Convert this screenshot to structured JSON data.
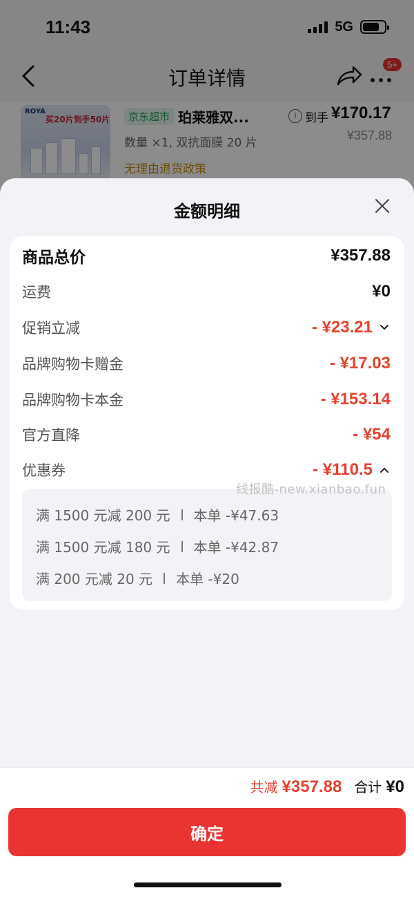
{
  "status_bar": {
    "time": "11:43",
    "network": "5G"
  },
  "nav": {
    "title": "订单详情",
    "badge": "5+"
  },
  "product": {
    "thumb_brand": "ROYA",
    "thumb_text": "买20片到手50片",
    "tag": "京东超市",
    "name": "珀莱雅双...",
    "spec": "数量 ×1, 双抗面膜 20 片",
    "policy": "无理由退货政策",
    "price_label": "到手",
    "price": "¥170.17",
    "original_price": "¥357.88"
  },
  "sheet": {
    "title": "金额明细",
    "rows": [
      {
        "label": "商品总价",
        "value": "¥357.88"
      },
      {
        "label": "运费",
        "value": "¥0"
      },
      {
        "label": "促销立减",
        "value": "- ¥23.21"
      },
      {
        "label": "品牌购物卡赠金",
        "value": "- ¥17.03"
      },
      {
        "label": "品牌购物卡本金",
        "value": "- ¥153.14"
      },
      {
        "label": "官方直降",
        "value": "- ¥54"
      },
      {
        "label": "优惠券",
        "value": "- ¥110.5"
      }
    ],
    "coupons": [
      {
        "rule": "满 1500 元减 200 元",
        "detail": "本单 -¥47.63"
      },
      {
        "rule": "满 1500 元减 180 元",
        "detail": "本单 -¥42.87"
      },
      {
        "rule": "满 200 元减 20 元",
        "detail": "本单 -¥20"
      }
    ],
    "watermark": "线报酷-new.xianbao.fun"
  },
  "footer": {
    "saved_label": "共减",
    "saved_value": "¥357.88",
    "total_label": "合计",
    "total_value": "¥0",
    "confirm_label": "确定"
  },
  "colors": {
    "accent_red": "#e93433",
    "discount_red": "#e5422f",
    "sheet_bg": "#f3f3f7"
  }
}
